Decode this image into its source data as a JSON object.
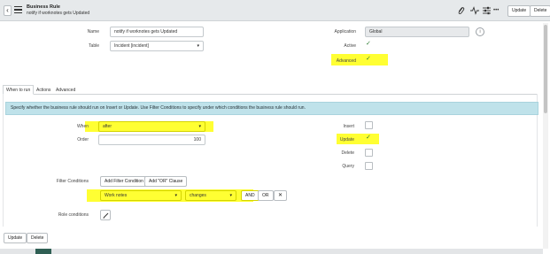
{
  "header": {
    "title": "Business Rule",
    "subtitle": "notify if worknotes gets Updated",
    "update_label": "Update",
    "delete_label": "Delete",
    "icons": [
      "paperclip-icon",
      "activity-icon",
      "settings-sliders-icon",
      "more-icon"
    ],
    "more_label": "•••"
  },
  "form": {
    "name_label": "Name",
    "name_value": "notify if worknotes gets Updated",
    "table_label": "Table",
    "table_value": "Incident [incident]",
    "application_label": "Application",
    "application_value": "Global",
    "active_label": "Active",
    "active_checked": true,
    "advanced_label": "Advanced",
    "advanced_checked": true
  },
  "tabs": [
    {
      "label": "When to run",
      "active": true
    },
    {
      "label": "Actions",
      "active": false
    },
    {
      "label": "Advanced",
      "active": false
    }
  ],
  "info_text": "Specify whether the business rule should run on Insert or Update. Use Filter Conditions to specify under which conditions the business rule should run.",
  "when_to_run": {
    "when_label": "When",
    "when_value": "after",
    "order_label": "Order",
    "order_value": "100",
    "insert_label": "Insert",
    "insert_checked": false,
    "update_label": "Update",
    "update_checked": true,
    "delete_label": "Delete",
    "delete_checked": false,
    "query_label": "Query",
    "query_checked": false,
    "filter_label": "Filter Conditions",
    "add_filter_label": "Add Filter Condition",
    "add_or_label": "Add \"OR\" Clause",
    "condition_field": "Work notes",
    "condition_operator": "changes",
    "and_label": "AND",
    "or_label": "OR",
    "remove_symbol": "✕",
    "role_label": "Role conditions"
  },
  "footer": {
    "update_label": "Update",
    "delete_label": "Delete"
  },
  "colors": {
    "highlight": "#ffff33",
    "info_background": "#bfe2ea",
    "checkmark": "#2e7d32"
  }
}
